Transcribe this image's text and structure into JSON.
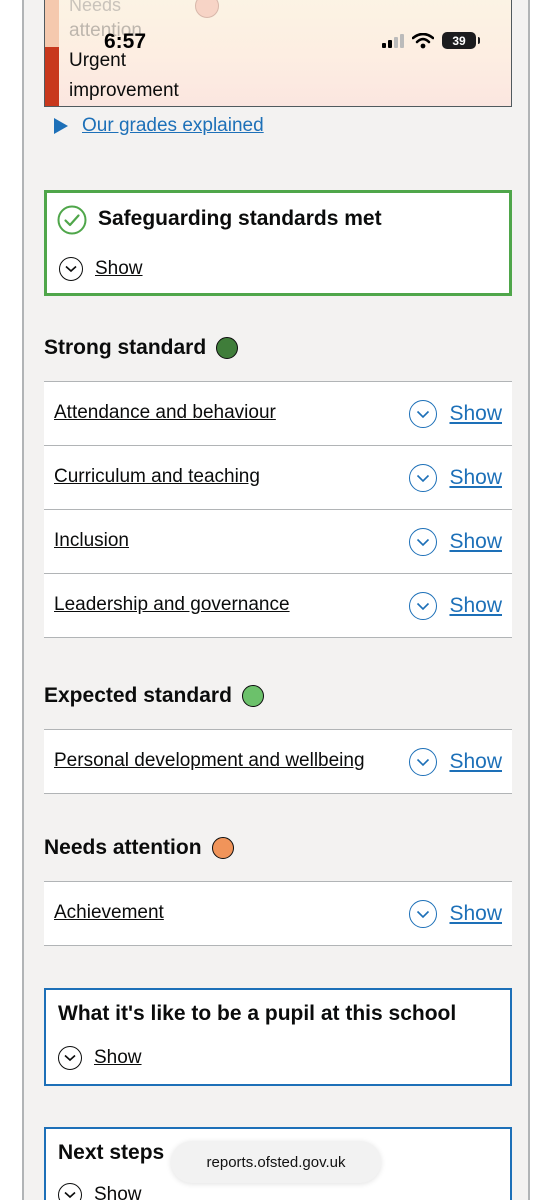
{
  "status_bar": {
    "time": "6:57",
    "battery": "39"
  },
  "grades_key": {
    "faded_top": "Needs",
    "needs_attention": "attention",
    "urgent": "Urgent",
    "improvement": "improvement"
  },
  "grades_link": "Our grades explained",
  "safeguarding": {
    "title": "Safeguarding standards met",
    "show": "Show"
  },
  "sections": [
    {
      "heading": "Strong standard",
      "color": "#3f7d3a",
      "rows": [
        {
          "label": "Attendance and behaviour",
          "show": "Show"
        },
        {
          "label": "Curriculum and teaching",
          "show": "Show"
        },
        {
          "label": "Inclusion",
          "show": "Show"
        },
        {
          "label": "Leadership and governance",
          "show": "Show"
        }
      ]
    },
    {
      "heading": "Expected standard",
      "color": "#6cc16b",
      "rows": [
        {
          "label": "Personal development and wellbeing",
          "show": "Show"
        }
      ]
    },
    {
      "heading": "Needs attention",
      "color": "#f0945a",
      "rows": [
        {
          "label": "Achievement",
          "show": "Show"
        }
      ]
    }
  ],
  "pupil_box": {
    "title": "What it's like to be a pupil at this school",
    "show": "Show"
  },
  "next_steps": {
    "title": "Next steps",
    "show": "Show"
  },
  "url": "reports.ofsted.gov.uk",
  "colors": {
    "link": "#1d70b8",
    "safeguard_border": "#4fa64a",
    "urgent": "#c8381d"
  }
}
